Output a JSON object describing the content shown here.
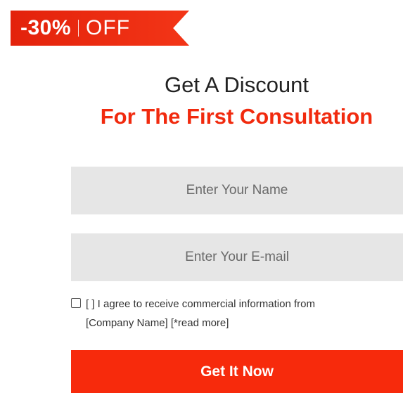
{
  "badge": {
    "percent": "-30%",
    "label": "OFF",
    "color": "#f12a0e"
  },
  "heading": {
    "line1": "Get A Discount",
    "line2": "For The First Consultation"
  },
  "form": {
    "name_placeholder": "Enter Your Name",
    "email_placeholder": "Enter Your E-mail",
    "consent_line1": "[ ] I agree to receive commercial information from",
    "consent_line2": "[Company Name] [*read more]",
    "consent_checked": false,
    "submit_label": "Get It Now"
  },
  "colors": {
    "accent": "#f72a0c",
    "field_bg": "#e6e6e6"
  }
}
